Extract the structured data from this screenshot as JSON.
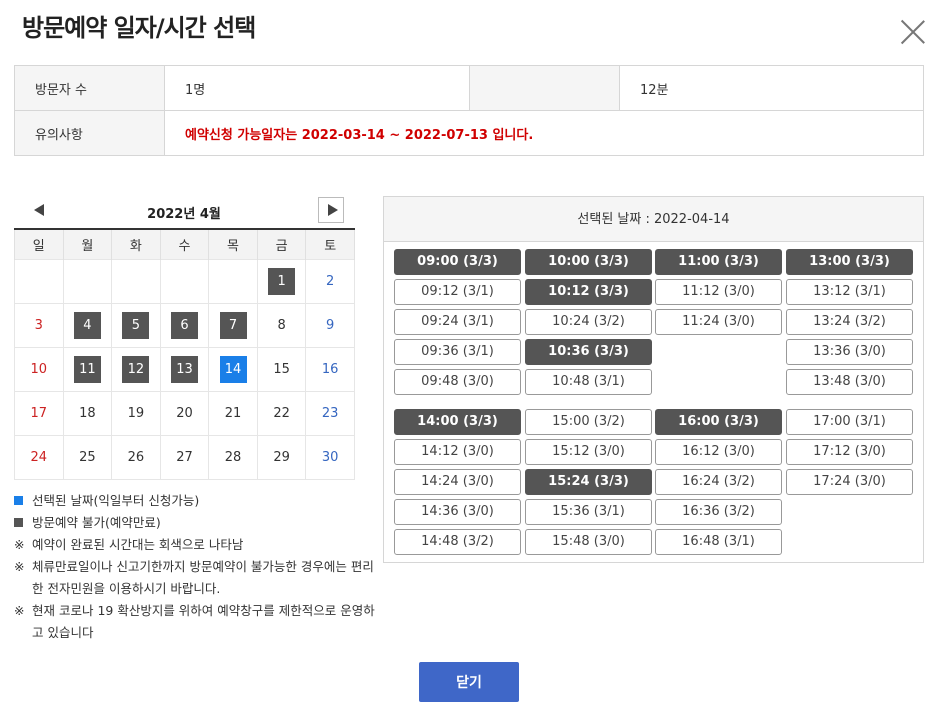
{
  "modal": {
    "title": "방문예약 일자/시간 선택"
  },
  "info": {
    "visitors_label": "방문자 수",
    "visitors_value": "1명",
    "empty_label": "",
    "duration_value": "12분",
    "notice_label": "유의사항",
    "notice_text": "예약신청 가능일자는 2022-03-14 ~ 2022-07-13 입니다."
  },
  "calendar": {
    "month_label": "2022년 4월",
    "weekdays": [
      "일",
      "월",
      "화",
      "수",
      "목",
      "금",
      "토"
    ],
    "weeks": [
      [
        "",
        "",
        "",
        "",
        "",
        "1",
        "2"
      ],
      [
        "3",
        "4",
        "5",
        "6",
        "7",
        "8",
        "9"
      ],
      [
        "10",
        "11",
        "12",
        "13",
        "14",
        "15",
        "16"
      ],
      [
        "17",
        "18",
        "19",
        "20",
        "21",
        "22",
        "23"
      ],
      [
        "24",
        "25",
        "26",
        "27",
        "28",
        "29",
        "30"
      ]
    ],
    "booked_days": [
      "1",
      "4",
      "5",
      "6",
      "7",
      "11",
      "12",
      "13"
    ],
    "selected_day": "14",
    "colors": {
      "booked": "#555555",
      "selected": "#1a7fe8",
      "sunday": "#cc2222",
      "saturday": "#3566c0"
    }
  },
  "legend": {
    "selected_text": "선택된 날짜(익일부터 신청가능)",
    "booked_text": "방문예약 불가(예약만료)",
    "notes": [
      "예약이 완료된 시간대는 회색으로 나타남",
      "체류만료일이나 신고기한까지 방문예약이 불가능한 경우에는 편리한 전자민원을 이용하시기 바랍니다.",
      "현재 코로나 19 확산방지를 위하여 예약창구를 제한적으로 운영하고 있습니다"
    ],
    "note_marker": "※"
  },
  "time_panel": {
    "header": "선택된 날짜 : 2022-04-14",
    "groups": [
      {
        "columns": [
          [
            {
              "label": "09:00 (3/3)",
              "full": true
            },
            {
              "label": "09:12 (3/1)",
              "full": false
            },
            {
              "label": "09:24 (3/1)",
              "full": false
            },
            {
              "label": "09:36 (3/1)",
              "full": false
            },
            {
              "label": "09:48 (3/0)",
              "full": false
            }
          ],
          [
            {
              "label": "10:00 (3/3)",
              "full": true
            },
            {
              "label": "10:12 (3/3)",
              "full": true
            },
            {
              "label": "10:24 (3/2)",
              "full": false
            },
            {
              "label": "10:36 (3/3)",
              "full": true
            },
            {
              "label": "10:48 (3/1)",
              "full": false
            }
          ],
          [
            {
              "label": "11:00 (3/3)",
              "full": true
            },
            {
              "label": "11:12 (3/0)",
              "full": false
            },
            {
              "label": "11:24 (3/0)",
              "full": false
            }
          ],
          [
            {
              "label": "13:00 (3/3)",
              "full": true
            },
            {
              "label": "13:12 (3/1)",
              "full": false
            },
            {
              "label": "13:24 (3/2)",
              "full": false
            },
            {
              "label": "13:36 (3/0)",
              "full": false
            },
            {
              "label": "13:48 (3/0)",
              "full": false
            }
          ]
        ]
      },
      {
        "columns": [
          [
            {
              "label": "14:00 (3/3)",
              "full": true
            },
            {
              "label": "14:12 (3/0)",
              "full": false
            },
            {
              "label": "14:24 (3/0)",
              "full": false
            },
            {
              "label": "14:36 (3/0)",
              "full": false
            },
            {
              "label": "14:48 (3/2)",
              "full": false
            }
          ],
          [
            {
              "label": "15:00 (3/2)",
              "full": false
            },
            {
              "label": "15:12 (3/0)",
              "full": false
            },
            {
              "label": "15:24 (3/3)",
              "full": true
            },
            {
              "label": "15:36 (3/1)",
              "full": false
            },
            {
              "label": "15:48 (3/0)",
              "full": false
            }
          ],
          [
            {
              "label": "16:00 (3/3)",
              "full": true
            },
            {
              "label": "16:12 (3/0)",
              "full": false
            },
            {
              "label": "16:24 (3/2)",
              "full": false
            },
            {
              "label": "16:36 (3/2)",
              "full": false
            },
            {
              "label": "16:48 (3/1)",
              "full": false
            }
          ],
          [
            {
              "label": "17:00 (3/1)",
              "full": false
            },
            {
              "label": "17:12 (3/0)",
              "full": false
            },
            {
              "label": "17:24 (3/0)",
              "full": false
            }
          ]
        ]
      }
    ]
  },
  "footer": {
    "close_label": "닫기"
  },
  "icons": {
    "close": "close-icon",
    "prev": "chevron-left-icon",
    "next": "chevron-right-icon"
  }
}
